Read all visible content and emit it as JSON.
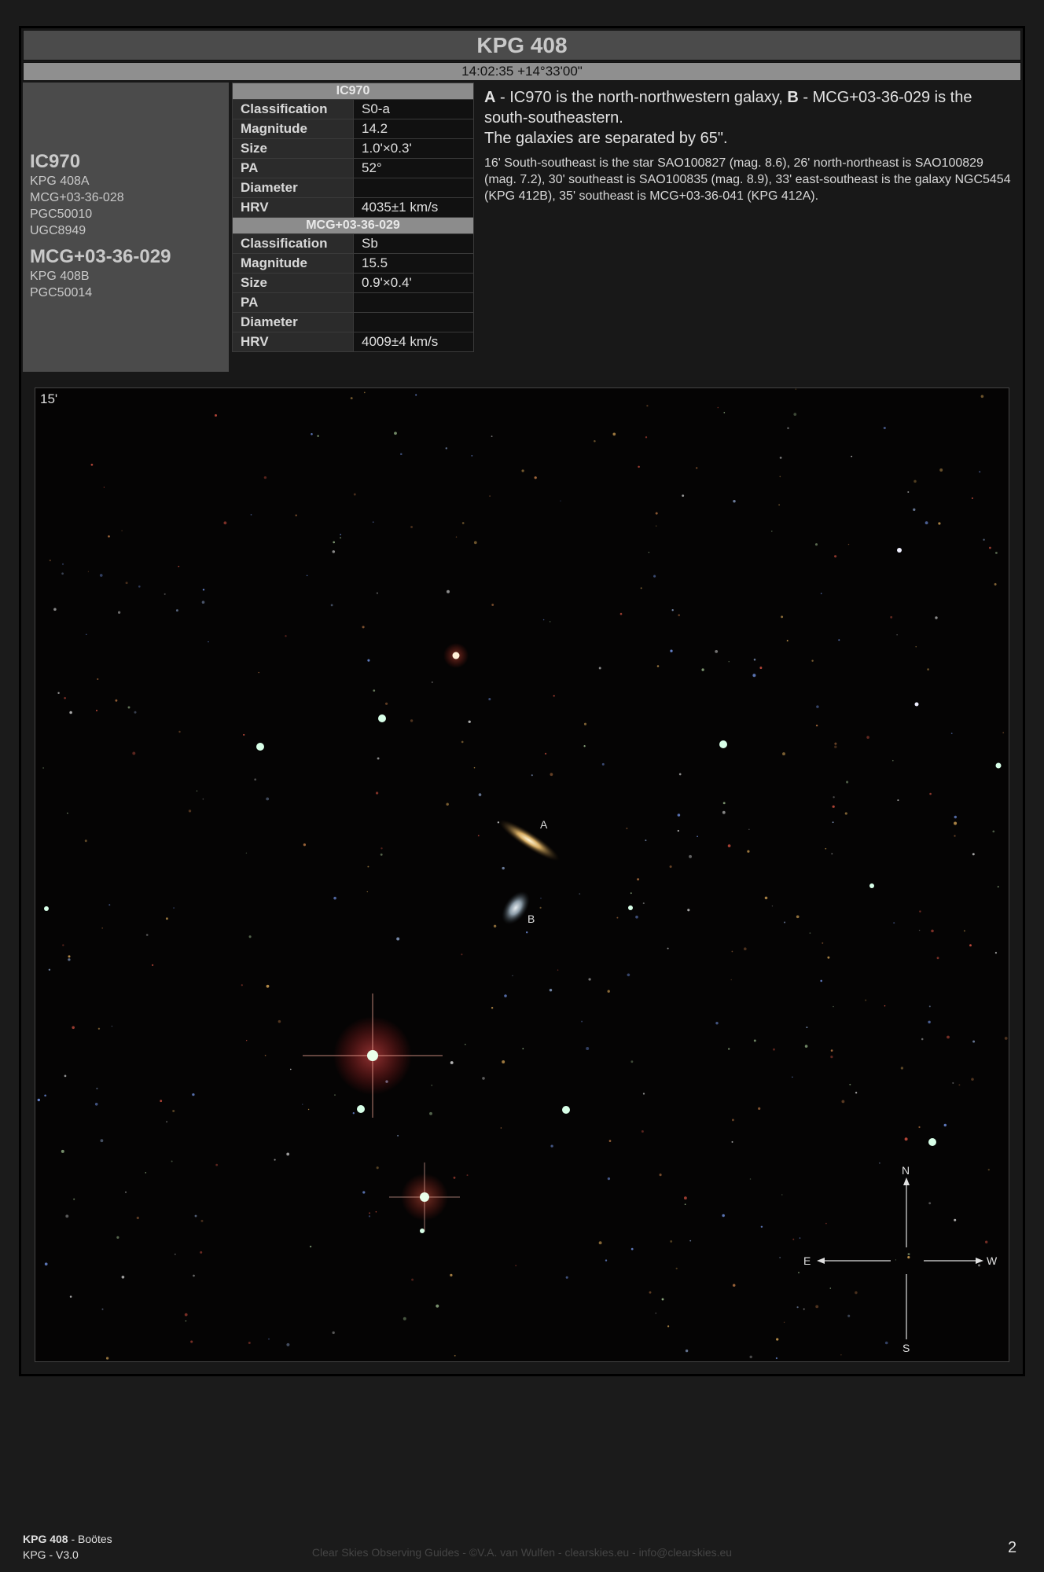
{
  "header": {
    "title": "KPG 408",
    "coordinates": "14:02:35 +14°33'00\""
  },
  "names": {
    "galaxy_a": {
      "primary": "IC970",
      "aliases": [
        "KPG 408A",
        "MCG+03-36-028",
        "PGC50010",
        "UGC8949"
      ]
    },
    "galaxy_b": {
      "primary": "MCG+03-36-029",
      "aliases": [
        "KPG 408B",
        "PGC50014"
      ]
    }
  },
  "table": {
    "galaxy_a": {
      "header": "IC970",
      "rows": [
        {
          "label": "Classification",
          "value": "S0-a"
        },
        {
          "label": "Magnitude",
          "value": "14.2"
        },
        {
          "label": "Size",
          "value": "1.0'×0.3'"
        },
        {
          "label": "PA",
          "value": "52°"
        },
        {
          "label": "Diameter",
          "value": ""
        },
        {
          "label": "HRV",
          "value": "4035±1 km/s"
        }
      ]
    },
    "galaxy_b": {
      "header": "MCG+03-36-029",
      "rows": [
        {
          "label": "Classification",
          "value": "Sb"
        },
        {
          "label": "Magnitude",
          "value": "15.5"
        },
        {
          "label": "Size",
          "value": "0.9'×0.4'"
        },
        {
          "label": "PA",
          "value": ""
        },
        {
          "label": "Diameter",
          "value": ""
        },
        {
          "label": "HRV",
          "value": "4009±4 km/s"
        }
      ]
    }
  },
  "description": {
    "a_letter": "A",
    "a_text": " - IC970 is the north-northwestern galaxy, ",
    "b_letter": "B",
    "b_text": " - MCG+03-36-029 is the south-southeastern.",
    "separation": "The galaxies are separated by 65\".",
    "surroundings": "16' South-southeast is the star SAO100827 (mag. 8.6), 26' north-northeast is SAO100829 (mag. 7.2), 30' southeast is SAO100835 (mag. 8.9), 33' east-southeast is the galaxy NGC5454 (KPG 412B), 35' southeast is MCG+03-36-041 (KPG 412A)."
  },
  "image": {
    "scale_label": "15'",
    "galaxy_label_a": "A",
    "galaxy_label_b": "B",
    "compass": {
      "north": "N",
      "south": "S",
      "east": "E",
      "west": "W"
    }
  },
  "footer": {
    "object": "KPG 408",
    "constellation": " - Boötes",
    "version": "KPG - V3.0",
    "credits": "Clear Skies Observing Guides - ©V.A. van Wulfen - clearskies.eu - info@clearskies.eu",
    "page_number": "2"
  }
}
